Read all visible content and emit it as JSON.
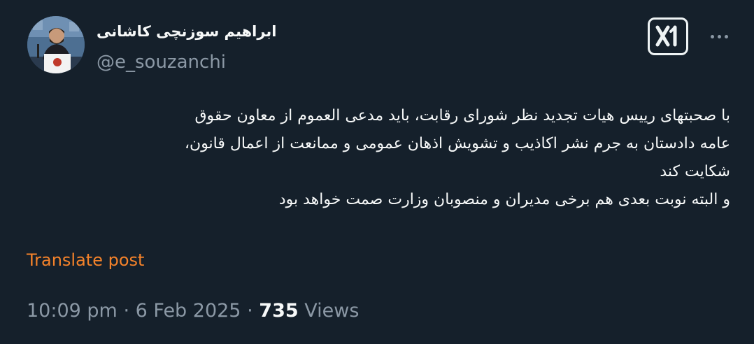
{
  "author": {
    "display_name": "ابراهیم سوزنچی کاشانی",
    "handle": "@e_souzanchi"
  },
  "header": {
    "grok_icon": "grok-logo-icon",
    "more_icon": "more-horizontal-icon"
  },
  "post": {
    "lines": [
      "با صحبتهای رییس هیات تجدید نظر شورای رقابت، باید مدعی العموم از معاون حقوق",
      "عامه دادستان به جرم نشر اکاذیب و تشویش اذهان عمومی و ممانعت از اعمال قانون،",
      "شکایت کند",
      "و البته نوبت بعدی هم برخی مدیران و منصوبان وزارت صمت خواهد بود"
    ]
  },
  "translate_label": "Translate post",
  "meta": {
    "time": "10:09 pm",
    "separator": "·",
    "date": "6 Feb 2025",
    "views_count": "735",
    "views_label": "Views"
  },
  "colors": {
    "background": "#15202b",
    "text": "#f7f9f9",
    "secondary": "#8b98a5",
    "accent": "#f4822a"
  }
}
